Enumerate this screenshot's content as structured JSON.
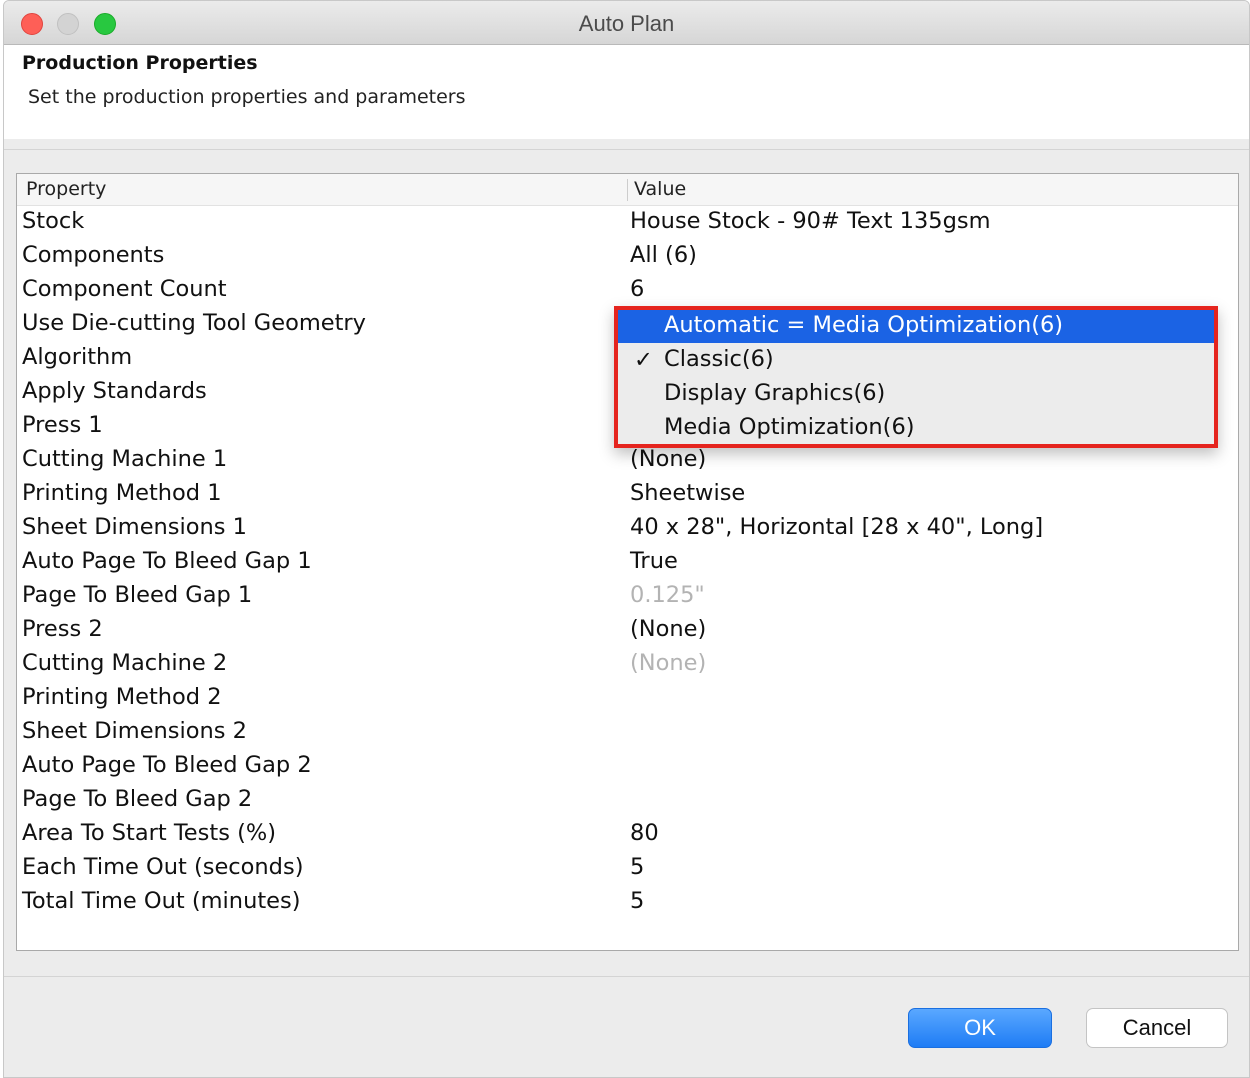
{
  "window": {
    "title": "Auto Plan"
  },
  "header": {
    "title": "Production Properties",
    "subtitle": "Set the production properties and parameters"
  },
  "table": {
    "columns": [
      "Property",
      "Value"
    ],
    "rows": [
      {
        "property": "Stock",
        "value": "House Stock - 90# Text 135gsm",
        "disabled": false
      },
      {
        "property": "Components",
        "value": "All (6)",
        "disabled": false
      },
      {
        "property": "Component Count",
        "value": "6",
        "disabled": false
      },
      {
        "property": "Use Die-cutting Tool Geometry",
        "value": "",
        "disabled": false
      },
      {
        "property": "Algorithm",
        "value": "",
        "disabled": false
      },
      {
        "property": "Apply Standards",
        "value": "",
        "disabled": false
      },
      {
        "property": "Press 1",
        "value": "",
        "disabled": false
      },
      {
        "property": "Cutting Machine 1",
        "value": "(None)",
        "disabled": false
      },
      {
        "property": "Printing Method 1",
        "value": "Sheetwise",
        "disabled": false
      },
      {
        "property": "Sheet Dimensions 1",
        "value": "40 x 28\", Horizontal [28 x 40\", Long]",
        "disabled": false
      },
      {
        "property": "Auto Page To Bleed Gap 1",
        "value": "True",
        "disabled": false
      },
      {
        "property": "Page To Bleed Gap 1",
        "value": "0.125\"",
        "disabled": true
      },
      {
        "property": "Press 2",
        "value": "(None)",
        "disabled": false
      },
      {
        "property": "Cutting Machine 2",
        "value": "(None)",
        "disabled": true
      },
      {
        "property": "Printing Method 2",
        "value": "",
        "disabled": false
      },
      {
        "property": "Sheet Dimensions 2",
        "value": "",
        "disabled": false
      },
      {
        "property": "Auto Page To Bleed Gap 2",
        "value": "",
        "disabled": false
      },
      {
        "property": "Page To Bleed Gap 2",
        "value": "",
        "disabled": false
      },
      {
        "property": "Area To Start Tests (%)",
        "value": "80",
        "disabled": false
      },
      {
        "property": "Each Time Out (seconds)",
        "value": "5",
        "disabled": false
      },
      {
        "property": "Total Time Out (minutes)",
        "value": "5",
        "disabled": false
      }
    ]
  },
  "dropdown": {
    "options": [
      {
        "label": "Automatic = Media Optimization(6)",
        "highlighted": true,
        "checked": false
      },
      {
        "label": "Classic(6)",
        "highlighted": false,
        "checked": true
      },
      {
        "label": "Display Graphics(6)",
        "highlighted": false,
        "checked": false
      },
      {
        "label": "Media Optimization(6)",
        "highlighted": false,
        "checked": false
      }
    ],
    "check_glyph": "✓",
    "highlight_color": "#1b63e4",
    "outline_color": "#e5241e"
  },
  "buttons": {
    "ok": "OK",
    "cancel": "Cancel"
  }
}
